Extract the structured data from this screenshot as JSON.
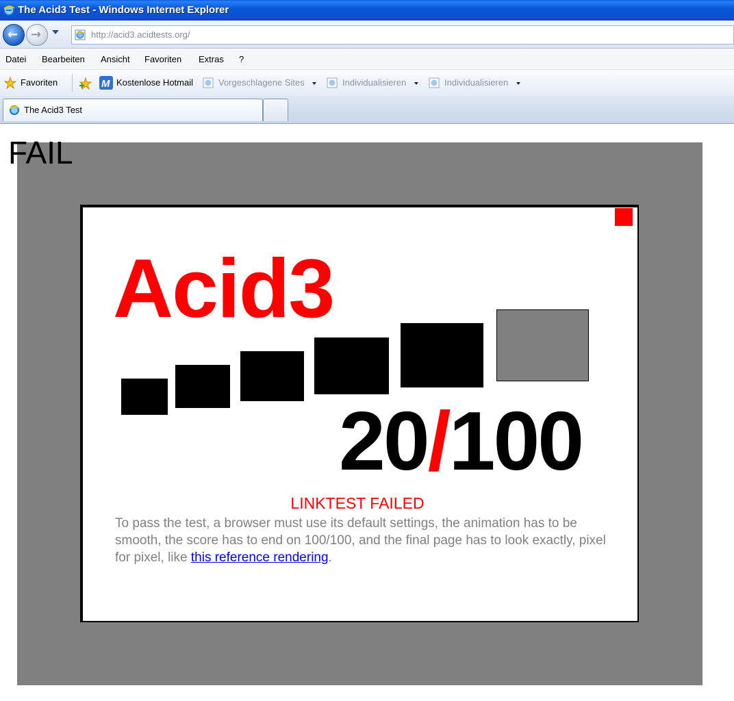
{
  "window": {
    "title": "The Acid3 Test - Windows Internet Explorer"
  },
  "address": {
    "url": "http://acid3.acidtests.org/"
  },
  "menu": {
    "items": [
      "Datei",
      "Bearbeiten",
      "Ansicht",
      "Favoriten",
      "Extras",
      "?"
    ]
  },
  "favorites": {
    "label": "Favoriten",
    "items": [
      "Kostenlose Hotmail",
      "Vorgeschlagene Sites",
      "Individualisieren",
      "Individualisieren"
    ]
  },
  "tabs": {
    "active_title": "The Acid3 Test"
  },
  "page": {
    "status": "FAIL",
    "heading": "Acid3",
    "score_num": "20",
    "score_slash": "/",
    "score_den": "100",
    "error": "LINKTEST FAILED",
    "description": "To pass the test, a browser must use its default settings, the animation has to be smooth, the score has to end on 100/100, and the final page has to look exactly, pixel for pixel, like ",
    "link_text": "this reference rendering",
    "description_end": "."
  },
  "colors": {
    "accent": "#ff0000",
    "background": "#808080"
  },
  "icons": [
    "ie-logo-icon",
    "back-arrow-icon",
    "forward-arrow-icon",
    "page-icon",
    "star-icon",
    "add-favorite-icon",
    "hotmail-icon"
  ]
}
